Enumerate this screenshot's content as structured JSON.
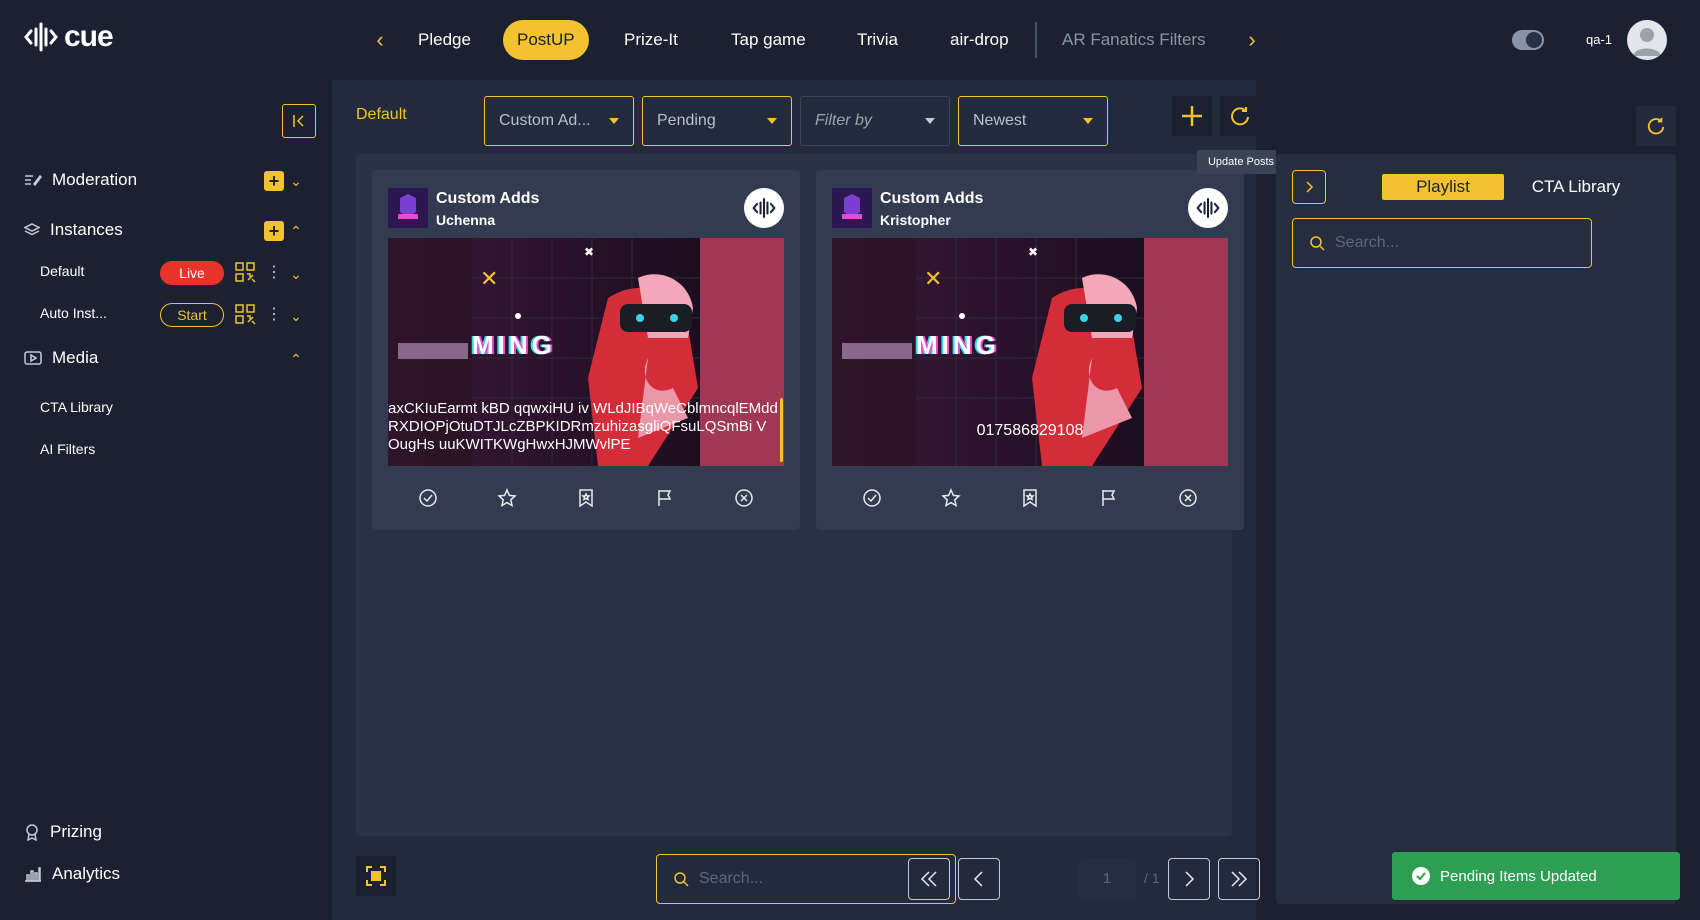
{
  "app": {
    "logo_text": "cue",
    "brand_color": "#f2c230"
  },
  "nav": {
    "tabs": [
      {
        "label": "Pledge",
        "active": false
      },
      {
        "label": "PostUP",
        "active": true
      },
      {
        "label": "Prize-It",
        "active": false
      },
      {
        "label": "Tap game",
        "active": false
      },
      {
        "label": "Trivia",
        "active": false
      },
      {
        "label": "air-drop",
        "active": false
      },
      {
        "label": "AR Fanatics Filters",
        "active": false
      }
    ],
    "prev_icon": "chevron-left-icon",
    "next_icon": "chevron-right-icon"
  },
  "user": {
    "name": "qa-1",
    "theme_toggle_icon": "theme-toggle-icon",
    "avatar_icon": "user-avatar-icon"
  },
  "sidebar": {
    "collapse_icon": "collapse-left-icon",
    "sections": [
      {
        "label": "Moderation",
        "icon": "moderation-icon"
      },
      {
        "label": "Instances",
        "icon": "layers-icon"
      },
      {
        "label": "Media",
        "icon": "media-icon"
      }
    ],
    "instances": [
      {
        "label": "Default",
        "status": "Live",
        "status_color": "#e8332b"
      },
      {
        "label": "Auto Inst...",
        "status": "Start"
      }
    ],
    "media_items": [
      {
        "label": "CTA Library"
      },
      {
        "label": "AI Filters"
      }
    ],
    "footer": [
      {
        "label": "Prizing",
        "icon": "award-icon"
      },
      {
        "label": "Analytics",
        "icon": "bar-chart-icon"
      }
    ]
  },
  "main": {
    "instance_label": "Default",
    "filters": {
      "type": "Custom Ad...",
      "status": "Pending",
      "filter_by_placeholder": "Filter by",
      "sort": "Newest"
    },
    "tooltip": "Update Posts",
    "cards": [
      {
        "title": "Custom Adds",
        "user": "Uchenna",
        "text": "axCKIuEarmt kBD qqwxiHU iv WLdJIBqWeCblmncqlEMdd RXDIOPjOtuDTJLcZBPKIDRmzuhizasgliQFsuLQSmBi VOugHs uuKWITKWgHwxHJMWvlPE",
        "media_word": "MING"
      },
      {
        "title": "Custom Adds",
        "user": "Kristopher",
        "text": "017586829108",
        "media_word": "MING"
      }
    ],
    "card_actions": [
      "approve-icon",
      "star-icon",
      "bookmark-icon",
      "flag-icon",
      "reject-icon"
    ],
    "search_placeholder": "Search...",
    "pagination": {
      "current": "1",
      "total": "/ 1"
    }
  },
  "right_panel": {
    "tabs": [
      {
        "label": "Playlist",
        "active": true
      },
      {
        "label": "CTA Library",
        "active": false
      }
    ],
    "search_placeholder": "Search..."
  },
  "toast": {
    "message": "Pending Items Updated",
    "color": "#2e9e52"
  }
}
